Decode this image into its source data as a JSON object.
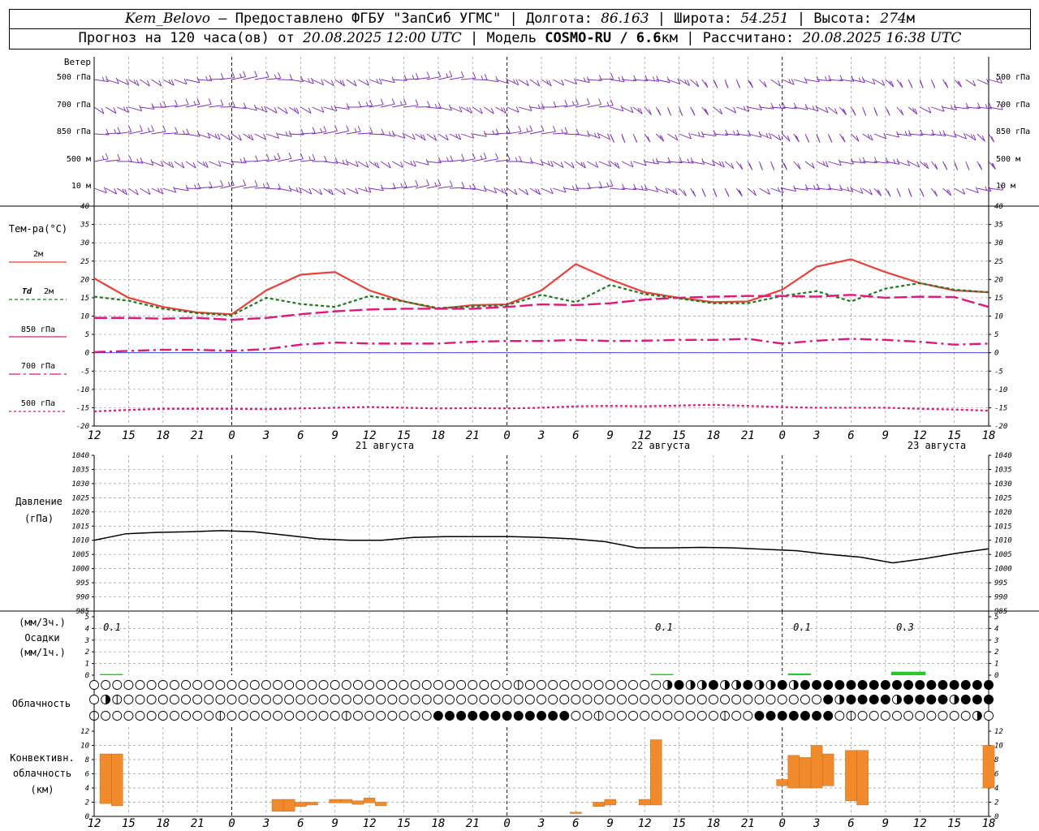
{
  "header": {
    "station": "Kem_Belovo",
    "provider": "Предоставлено ФГБУ \"ЗапСиб УГМС\"",
    "lon_label": "Долгота:",
    "lon": "86.163",
    "lat_label": "Широта:",
    "lat": "54.251",
    "alt_label": "Высота:",
    "alt": "274",
    "alt_unit": "м",
    "forecast_prefix": "Прогноз на 120 часа(ов) от",
    "start": "20.08.2025 12:00 UTC",
    "model_label": "Модель",
    "model": "COSMO-RU / 6.6",
    "model_unit": "км",
    "calc_label": "Рассчитано:",
    "calc": "20.08.2025 16:38 UTC"
  },
  "labels": {
    "wind": "Ветер",
    "wind_levels": [
      "500 гПа",
      "700 гПа",
      "850 гПа",
      "500 м",
      "10  м"
    ],
    "temp_title": "Тем-ра(°C)",
    "pressure_1": "Давление",
    "pressure_2": "(гПа)",
    "precip_1": "(мм/3ч.)",
    "precip_2": "Осадки",
    "precip_3": "(мм/1ч.)",
    "cloud": "Облачность",
    "conv_1": "Конвективн.",
    "conv_2": "облачность",
    "conv_3": "(км)"
  },
  "legend": [
    {
      "label": "2м",
      "prefix": "",
      "color": "#e8423c",
      "dash": ""
    },
    {
      "label": "2м",
      "prefix": "Td",
      "color": "#1f7a1f",
      "dash": "4,3"
    },
    {
      "label": "850 гПа",
      "prefix": "",
      "color": "#e0187a",
      "dash": ""
    },
    {
      "label": "700 гПа",
      "prefix": "",
      "color": "#e0187a",
      "dash": "14,4,3,4"
    },
    {
      "label": "500 гПа",
      "prefix": "",
      "color": "#e0187a",
      "dash": "3,3"
    }
  ],
  "colors": {
    "t2m": "#e8423c",
    "td2m": "#1f7a1f",
    "levels": "#e0187a",
    "wind": "#7a2ab8",
    "precip": "#22cc22",
    "conv": "#f08a2a",
    "zero_line": "#1a3ad0",
    "grid": "#999999"
  },
  "date_labels": [
    {
      "hour": 21,
      "text": "21 августа"
    },
    {
      "hour": 45,
      "text": "22 августа"
    },
    {
      "hour": 69,
      "text": "23 августа"
    }
  ],
  "hour_tick_labels": [
    "12",
    "15",
    "18",
    "21",
    "0",
    "3",
    "6",
    "9",
    "12",
    "15",
    "18",
    "21",
    "0",
    "3",
    "6",
    "9",
    "12",
    "15",
    "18",
    "21",
    "0",
    "3",
    "6",
    "9",
    "12",
    "15",
    "18"
  ],
  "precip_labels": [
    {
      "hour": 1.5,
      "text": "0.1"
    },
    {
      "hour": 49.5,
      "text": "0.1"
    },
    {
      "hour": 61.5,
      "text": "0.1"
    },
    {
      "hour": 70.5,
      "text": "0.3"
    }
  ],
  "chart_data": [
    {
      "type": "line",
      "panel": "temperature",
      "x_unit": "hours since 20.08.2025 12:00 UTC",
      "ylim": [
        -20,
        40
      ],
      "yticks": [
        40,
        35,
        30,
        25,
        20,
        15,
        10,
        5,
        0,
        -5,
        -10,
        -15,
        -20
      ],
      "grid": true,
      "x": [
        0,
        3,
        6,
        9,
        12,
        15,
        18,
        21,
        24,
        27,
        30,
        33,
        36,
        39,
        42,
        45,
        48,
        51,
        54,
        57,
        60,
        63,
        66,
        69,
        72,
        75,
        78
      ],
      "series": [
        {
          "name": "2м",
          "values": [
            20.3,
            15,
            12.5,
            11,
            10.5,
            17,
            21.3,
            22,
            17,
            14,
            12,
            13,
            13.2,
            17,
            24.2,
            20,
            16.5,
            15,
            13.8,
            14,
            17.2,
            23.5,
            25.5,
            22,
            19,
            17,
            16.5
          ]
        },
        {
          "name": "Td 2м",
          "values": [
            15.3,
            14.2,
            12,
            10.8,
            10.2,
            15,
            13.3,
            12.5,
            15.5,
            14,
            12.2,
            12.6,
            13,
            15.8,
            13.8,
            18.5,
            16,
            14.8,
            13.5,
            13.5,
            15.5,
            16.8,
            14,
            17.5,
            19,
            17.2,
            16.5
          ]
        },
        {
          "name": "850 гПа",
          "values": [
            9.5,
            9.5,
            9.3,
            9.5,
            9,
            9.5,
            10.5,
            11.3,
            11.8,
            12,
            12,
            12,
            12.5,
            13.2,
            13,
            13.5,
            14.5,
            15,
            15.3,
            15.5,
            15.5,
            15.3,
            15.8,
            15,
            15.3,
            15.2,
            12.5
          ]
        },
        {
          "name": "700 гПа",
          "values": [
            0.2,
            0.5,
            0.8,
            0.8,
            0.5,
            1,
            2.2,
            2.8,
            2.5,
            2.5,
            2.5,
            3,
            3.2,
            3.2,
            3.5,
            3.2,
            3.3,
            3.5,
            3.5,
            3.8,
            2.5,
            3.3,
            3.8,
            3.5,
            3,
            2.2,
            2.5
          ]
        },
        {
          "name": "500 гПа",
          "values": [
            -16,
            -15.6,
            -15.3,
            -15.3,
            -15.3,
            -15.4,
            -15.2,
            -15,
            -14.8,
            -15,
            -15.2,
            -15.1,
            -15.2,
            -15,
            -14.6,
            -14.5,
            -14.6,
            -14.4,
            -14.2,
            -14.5,
            -14.8,
            -15,
            -15,
            -15,
            -15.3,
            -15.5,
            -15.8
          ]
        }
      ]
    },
    {
      "type": "line",
      "panel": "pressure",
      "ylabel": "(гПа)",
      "ylim": [
        985,
        1040
      ],
      "yticks": [
        1040,
        1035,
        1030,
        1025,
        1020,
        1015,
        1010,
        1005,
        1000,
        995,
        990,
        985
      ],
      "grid": true,
      "x": [
        0,
        3,
        6,
        9,
        12,
        15,
        18,
        21,
        24,
        27,
        30,
        33,
        36,
        39,
        42,
        45,
        48,
        51,
        54,
        57,
        60,
        63,
        66,
        69,
        72,
        75,
        78
      ],
      "series": [
        {
          "name": "",
          "values": [
            1010,
            1012.3,
            1012.8,
            1013,
            1013.4,
            1013,
            1011.8,
            1010.5,
            1010,
            1010,
            1011,
            1011.3,
            1011.3,
            1011.3,
            1011,
            1010.5,
            1009.5,
            1007.3,
            1007.3,
            1007.5,
            1007.3,
            1006.8,
            1006.3,
            1005,
            1004,
            1002,
            1003.5,
            1005.4,
            1007
          ]
        }
      ]
    },
    {
      "type": "bar",
      "panel": "precipitation",
      "ylim": [
        0,
        5
      ],
      "yticks": [
        5,
        4,
        3,
        2,
        1,
        0
      ],
      "x": [
        1,
        2,
        49,
        50,
        61,
        62,
        70,
        71,
        72
      ],
      "values": [
        0.1,
        0.1,
        0.1,
        0.1,
        0.15,
        0.15,
        0.3,
        0.3,
        0.3
      ]
    },
    {
      "type": "bar",
      "panel": "convective_cloud",
      "ylabel": "(км)",
      "ylim": [
        0,
        12
      ],
      "yticks": [
        12,
        10,
        8,
        6,
        4,
        2,
        0
      ],
      "bars": [
        {
          "x": 1,
          "bottom": 1.8,
          "top": 8.8
        },
        {
          "x": 2,
          "bottom": 1.5,
          "top": 8.8
        },
        {
          "x": 16,
          "bottom": 0.7,
          "top": 2.4
        },
        {
          "x": 17,
          "bottom": 0.7,
          "top": 2.4
        },
        {
          "x": 18,
          "bottom": 1.4,
          "top": 2.0
        },
        {
          "x": 19,
          "bottom": 1.6,
          "top": 2.0
        },
        {
          "x": 21,
          "bottom": 1.9,
          "top": 2.4
        },
        {
          "x": 22,
          "bottom": 1.9,
          "top": 2.4
        },
        {
          "x": 23,
          "bottom": 1.7,
          "top": 2.2
        },
        {
          "x": 24,
          "bottom": 1.9,
          "top": 2.6
        },
        {
          "x": 25,
          "bottom": 1.5,
          "top": 2.0
        },
        {
          "x": 42,
          "bottom": 0.4,
          "top": 0.6
        },
        {
          "x": 44,
          "bottom": 1.4,
          "top": 2.0
        },
        {
          "x": 45,
          "bottom": 1.6,
          "top": 2.4
        },
        {
          "x": 48,
          "bottom": 1.6,
          "top": 2.4
        },
        {
          "x": 49,
          "bottom": 1.6,
          "top": 10.8
        },
        {
          "x": 60,
          "bottom": 4.3,
          "top": 5.2
        },
        {
          "x": 61,
          "bottom": 4.0,
          "top": 8.6
        },
        {
          "x": 62,
          "bottom": 4.0,
          "top": 8.3
        },
        {
          "x": 63,
          "bottom": 4.0,
          "top": 10.0
        },
        {
          "x": 64,
          "bottom": 4.3,
          "top": 8.8
        },
        {
          "x": 66,
          "bottom": 2.2,
          "top": 9.3
        },
        {
          "x": 67,
          "bottom": 1.6,
          "top": 9.3
        },
        {
          "x": 78,
          "bottom": 4.0,
          "top": 10.0
        }
      ]
    }
  ]
}
